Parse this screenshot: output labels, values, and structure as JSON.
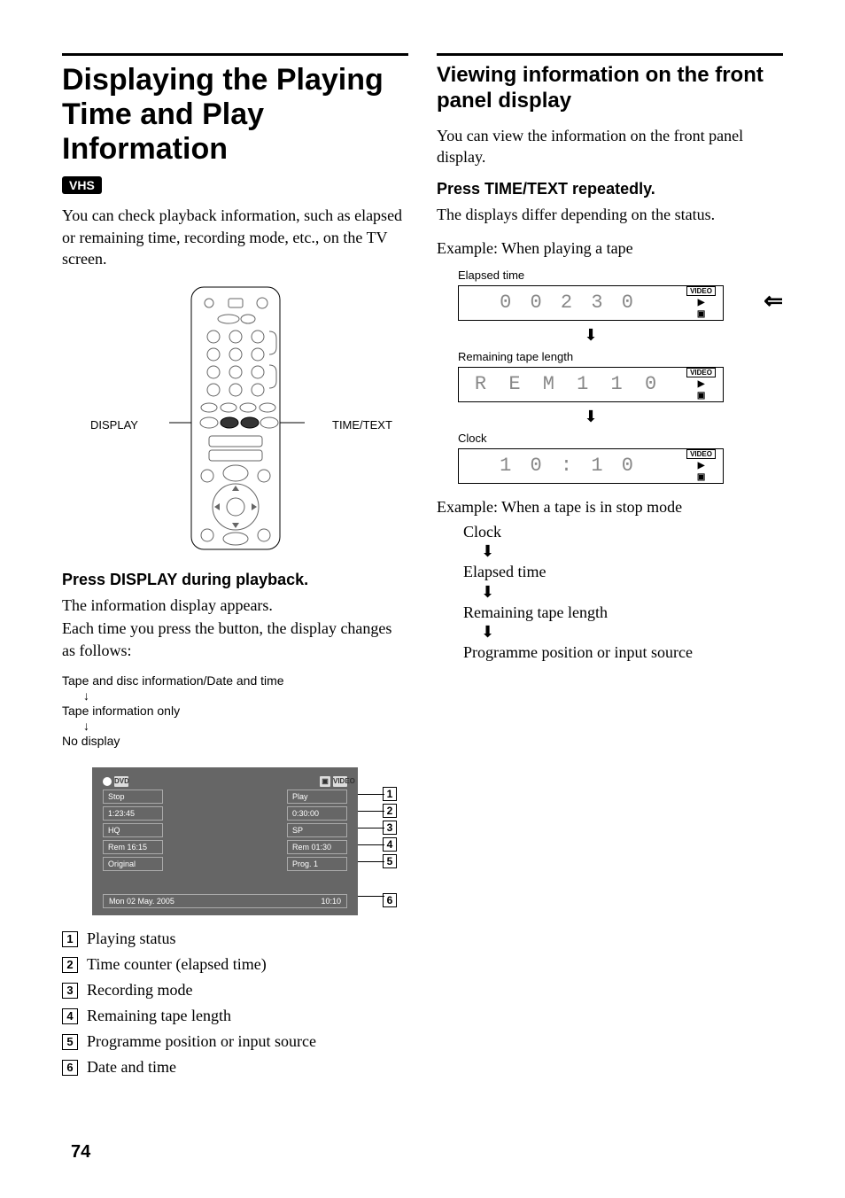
{
  "left": {
    "title": "Displaying the Playing Time and Play Information",
    "badge": "VHS",
    "intro": "You can check playback information, such as elapsed or remaining time, recording mode, etc., on the TV screen.",
    "remoteLabels": {
      "display": "DISPLAY",
      "timetext": "TIME/TEXT"
    },
    "pressHeading": "Press DISPLAY during playback.",
    "pressBody1": "The information display appears.",
    "pressBody2": "Each time you press the button, the display changes as follows:",
    "flow": {
      "a": "Tape and disc information/Date and time",
      "b": "Tape information only",
      "c": "No display"
    },
    "osd": {
      "dvdHeader": "DVD",
      "videoHeader": "VIDEO",
      "dvdCol": [
        "Stop",
        "1:23:45",
        "HQ",
        "Rem 16:15",
        "Original"
      ],
      "vhsCol": [
        "Play",
        "0:30:00",
        "SP",
        "Rem 01:30",
        "Prog. 1"
      ],
      "date": "Mon 02 May. 2005",
      "time": "10:10"
    },
    "legend": [
      "Playing status",
      "Time counter (elapsed time)",
      "Recording mode",
      "Remaining tape length",
      "Programme position or input source",
      "Date and time"
    ]
  },
  "right": {
    "title": "Viewing information on the front panel display",
    "intro": "You can view the information on the front panel display.",
    "pressHeading": "Press TIME/TEXT repeatedly.",
    "pressBody": "The displays differ depending on the status.",
    "example1": "Example: When playing a tape",
    "panels": {
      "elapsedLabel": "Elapsed time",
      "elapsedValue": "0 0 2 3 0",
      "remainLabel": "Remaining tape length",
      "remainValue": "R E M   1 1 0",
      "clockLabel": "Clock",
      "clockValue": "1 0 : 1 0",
      "videoTag": "VIDEO"
    },
    "example2": "Example: When a tape is in stop mode",
    "stopFlow": [
      "Clock",
      "Elapsed time",
      "Remaining tape length",
      "Programme position or input source"
    ]
  },
  "pageNumber": "74"
}
